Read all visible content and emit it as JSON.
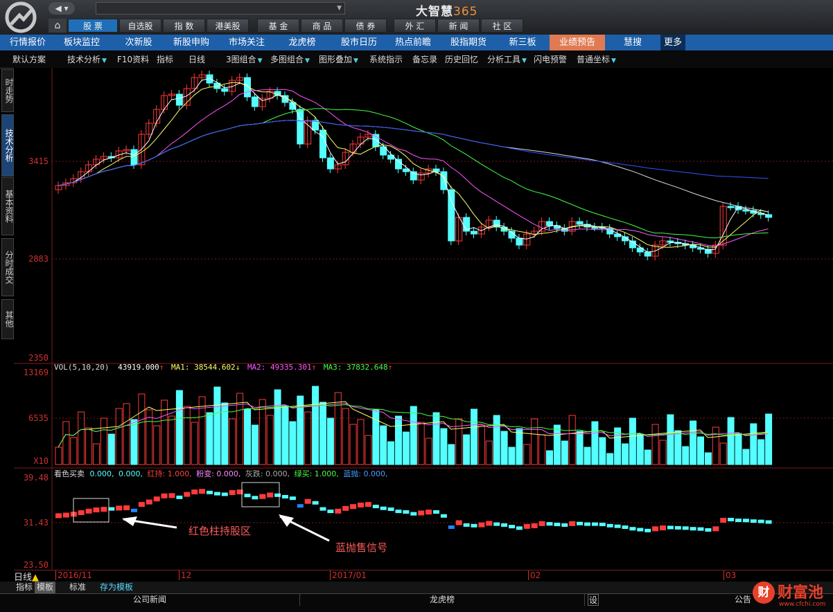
{
  "app": {
    "title_main": "大智慧",
    "title_num": "365",
    "back_label": "◀ ▾"
  },
  "top_nav": [
    {
      "label": "股 票",
      "active": true
    },
    {
      "label": "自选股"
    },
    {
      "label": "指 数"
    },
    {
      "label": "港美股"
    },
    {
      "label": "基 金"
    },
    {
      "label": "商 品"
    },
    {
      "label": "债 券"
    },
    {
      "label": "外 汇"
    },
    {
      "label": "新 闻"
    },
    {
      "label": "社 区"
    }
  ],
  "blue_nav": [
    {
      "label": "行情报价"
    },
    {
      "label": "板块监控"
    },
    {
      "label": "次新股"
    },
    {
      "label": "新股申购"
    },
    {
      "label": "市场关注"
    },
    {
      "label": "龙虎榜"
    },
    {
      "label": "股市日历"
    },
    {
      "label": "热点前瞻"
    },
    {
      "label": "股指期货"
    },
    {
      "label": "新三板"
    },
    {
      "label": "业绩预告"
    },
    {
      "label": "慧搜"
    },
    {
      "label": "更多"
    }
  ],
  "toolbar": [
    {
      "label": "默认方案"
    },
    {
      "label": "技术分析"
    },
    {
      "label": "F10资料"
    },
    {
      "label": "指标"
    },
    {
      "label": "日线"
    },
    {
      "label": "3图组合"
    },
    {
      "label": "多图组合"
    },
    {
      "label": "图形叠加"
    },
    {
      "label": "系统指示"
    },
    {
      "label": "备忘录"
    },
    {
      "label": "历史回忆"
    },
    {
      "label": "分析工具"
    },
    {
      "label": "闪电预警"
    },
    {
      "label": "普通坐标"
    }
  ],
  "left_tabs": [
    {
      "label": "时走势"
    },
    {
      "label": "技术分析",
      "active": true
    },
    {
      "label": "基本资料"
    },
    {
      "label": "分时成交"
    },
    {
      "label": "其他"
    }
  ],
  "price_axis": {
    "ticks": [
      "3415",
      "2883",
      "2350"
    ]
  },
  "vol_axis": {
    "ticks": [
      "13169",
      "6535",
      "X10"
    ]
  },
  "ind_axis": {
    "ticks": [
      "39.48",
      "31.43",
      "23.50"
    ]
  },
  "vol_header": {
    "name": "VOL(5,10,20)",
    "vol": "43919.000",
    "ma1": "MA1: 38544.602",
    "ma2": "MA2: 49335.301",
    "ma3": "MA3: 37832.648"
  },
  "indicator_header": {
    "name": "看色买卖",
    "v1": "0.000,",
    "v2": "0.000,",
    "hold": "红持: 1.000,",
    "pink": "粉变: 0.000,",
    "gray": "灰跌: 0.000,",
    "green": "绿买: 1.000,",
    "blue": "蓝抛: 0.000,"
  },
  "annotations": {
    "red_hold": "红色柱持股区",
    "blue_sell": "蓝抛售信号"
  },
  "date_axis": {
    "labels": [
      "2016/11",
      "12",
      "2017/01",
      "02",
      "03"
    ]
  },
  "status": {
    "period": "日线"
  },
  "bottom_tabs": [
    {
      "label": "指标"
    },
    {
      "label": "模板"
    },
    {
      "label": "标准"
    },
    {
      "label": "存为模板"
    }
  ],
  "bottom_panel": {
    "news": "公司新闻",
    "dragon": "龙虎榜",
    "settings": "设",
    "notice": "公告"
  },
  "watermark": {
    "text": "财富池",
    "url": "www.cfchi.com"
  },
  "colors": {
    "up": "#ff3b3b",
    "down": "#54ffff",
    "accent_blue": "#1d5fa8",
    "highlight": "#e07a53"
  }
}
